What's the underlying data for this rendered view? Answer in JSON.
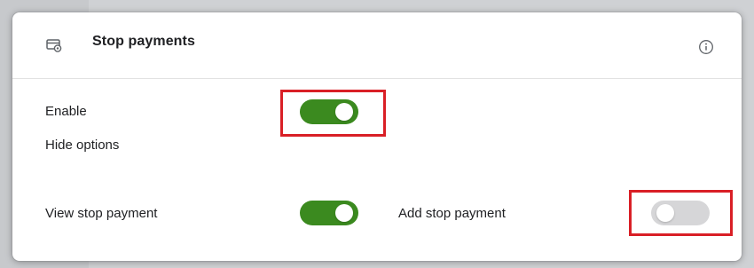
{
  "section": {
    "title": "Stop payments",
    "icon": "payment-card-settings-icon",
    "info_icon": "info-icon"
  },
  "enable": {
    "label": "Enable",
    "state": "on"
  },
  "options_link": {
    "label": "Hide options"
  },
  "view_stop_payment": {
    "label": "View stop payment",
    "state": "on"
  },
  "add_stop_payment": {
    "label": "Add stop payment",
    "state": "off"
  },
  "colors": {
    "toggle_on": "#3b8a1f",
    "toggle_off": "#d6d6d8",
    "highlight": "#d91f26"
  }
}
